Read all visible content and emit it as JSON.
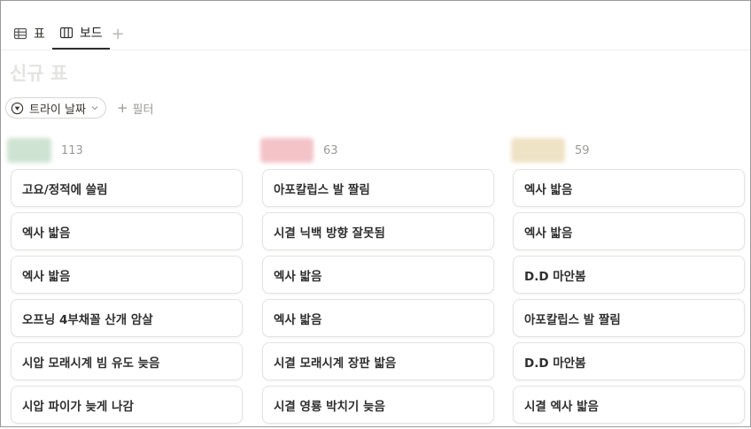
{
  "tabs": [
    {
      "label": "표",
      "icon": "table-icon",
      "active": false
    },
    {
      "label": "보드",
      "icon": "board-icon",
      "active": true
    }
  ],
  "add_view_label": "+",
  "page_title": "신규 표",
  "filters": {
    "active_filter_label": "트라이 날짜",
    "add_filter_label": "필터",
    "add_filter_icon": "+"
  },
  "columns": [
    {
      "count": "113",
      "color": "#cfe3d2",
      "cards": [
        "고요/정적에 쓸림",
        "엑사 밟음",
        "엑사 밟음",
        "오프닝 4부채꼴 산개 암살",
        "시압 모래시계 빔 유도 늦음",
        "시압 파이가 늦게 나감"
      ]
    },
    {
      "count": "63",
      "color": "#f3c3c8",
      "cards": [
        "아포칼립스 발 짤림",
        "시결 닉백 방향 잘못됨",
        "엑사 밟음",
        "엑사 밟음",
        "시결 모래시계 장판 밟음",
        "시결 영룡 박치기 늦음"
      ]
    },
    {
      "count": "59",
      "color": "#efe3c6",
      "cards": [
        "엑사 밟음",
        "엑사 밟음",
        "D.D 마안봄",
        "아포칼립스 발 짤림",
        "D.D 마안봄",
        "시결 엑사 밟음"
      ]
    }
  ]
}
